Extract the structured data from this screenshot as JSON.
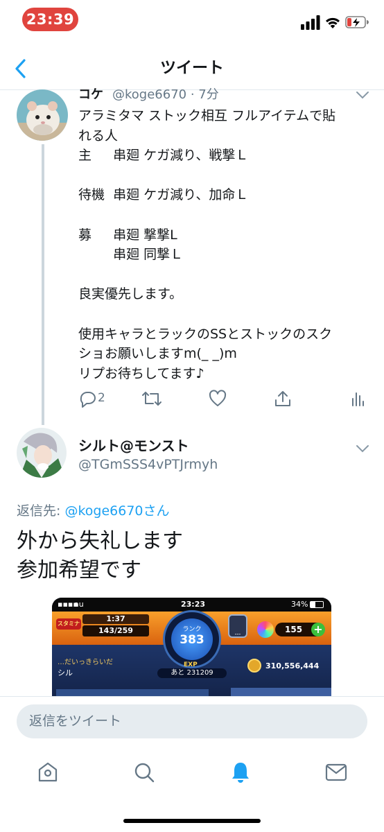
{
  "status": {
    "time": "23:39"
  },
  "nav": {
    "title": "ツイート"
  },
  "tweet1": {
    "name": "コケ",
    "handle_time": "@koge6670 · 7分",
    "lines": [
      "アラミタマ ストック相互 フルアイテムで貼",
      "れる人",
      "主　  串廻 ケガ減り、戦撃Ｌ",
      "",
      "待機  串廻 ケガ減り、加命Ｌ",
      "",
      "募　  串廻 撃撃L",
      "　　  串廻 同撃Ｌ",
      "",
      "良実優先します。",
      "",
      "使用キャラとラックのSSとストックのスク",
      "ショお願いしますm(_ _)m",
      "リプお待ちしてます♪"
    ],
    "reply_count": "2"
  },
  "tweet2": {
    "name": "シルト@モンスト",
    "handle": "@TGmSSS4vPTJrmyh",
    "reply_label": "返信先: ",
    "reply_handle": "@koge6670さん",
    "body_lines": [
      "外から失礼します",
      "参加希望です"
    ]
  },
  "screenshot": {
    "carrier": "au",
    "time": "23:23",
    "battery": "34%",
    "stamina_label": "スタミナ",
    "stamina_time": "1:37",
    "stamina_value": "143/259",
    "rank_label": "ランク",
    "rank": "383",
    "exp_label": "EXP",
    "exp_remaining": "あと 231209",
    "orbs": "155",
    "coins": "310,556,444",
    "title_text": "…だいっきらいだ",
    "player_name": "シル",
    "slot_label": "---"
  },
  "reply_input": {
    "placeholder": "返信をツイート"
  },
  "colors": {
    "accent": "#1da1f2",
    "secondary": "#657786",
    "status_red": "#e0443e"
  }
}
